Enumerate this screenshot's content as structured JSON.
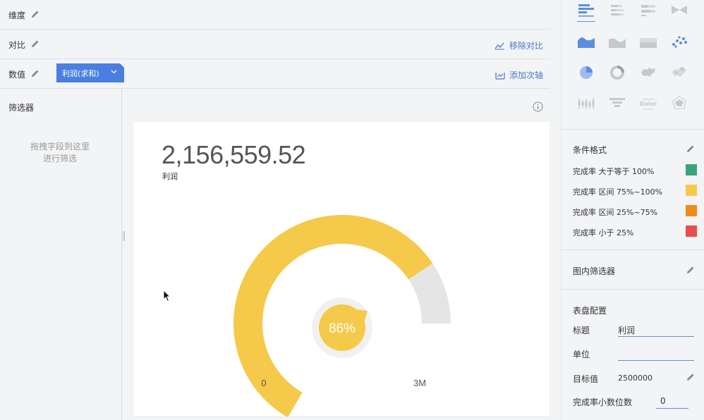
{
  "rows": {
    "dimension_label": "维度",
    "compare_label": "对比",
    "value_label": "数值",
    "remove_compare": "移除对比",
    "add_secondary_axis": "添加次轴",
    "value_field_tag": "利润(求和)"
  },
  "filter": {
    "title": "筛选器",
    "hint_line1": "拖拽字段到这里",
    "hint_line2": "进行筛选"
  },
  "chart": {
    "kpi_value": "2,156,559.52",
    "kpi_label": "利润"
  },
  "chart_data": {
    "type": "gauge",
    "value": 2156559.52,
    "target": 2500000,
    "percent_label": "86%",
    "percent": 0.86,
    "min_label": "0",
    "max_label": "3M",
    "color": "#f5c94a",
    "track_color": "#e5e5e5"
  },
  "right_panel": {
    "chart_types": [
      "bar-horizontal-icon",
      "bar-stacked-icon",
      "bar-percent-icon",
      "funnel-bar-icon",
      "area-icon",
      "area-smooth-icon",
      "area-stacked-icon",
      "scatter-icon",
      "pie-icon",
      "ring-icon",
      "map-icon",
      "map-bubble-icon",
      "box-plot-icon",
      "funnel-icon",
      "word-cloud-icon",
      "radar-icon"
    ],
    "word_cloud_text": "Dolor",
    "conditional_format_title": "条件格式",
    "rules": [
      {
        "text": "完成率 大于等于 100%",
        "color": "#3aa57a"
      },
      {
        "text": "完成率 区间 75%~100%",
        "color": "#f5c94a"
      },
      {
        "text": "完成率 区间 25%~75%",
        "color": "#f08a1c"
      },
      {
        "text": "完成率 小于 25%",
        "color": "#e84d4d"
      }
    ],
    "inner_filter_title": "图内筛选器",
    "gauge_config_title": "表盘配置",
    "title_label": "标题",
    "title_value": "利润",
    "unit_label": "单位",
    "unit_value": "",
    "target_label": "目标值",
    "target_value": "2500000",
    "decimals_label": "完成率小数位数",
    "decimals_value": "0"
  }
}
